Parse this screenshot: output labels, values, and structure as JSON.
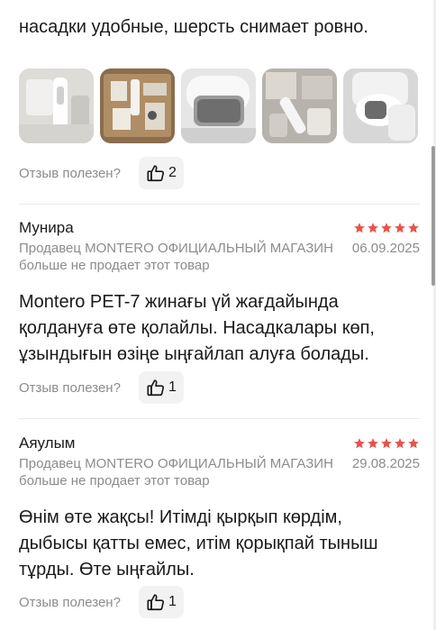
{
  "previous_review": {
    "text_tail": "насадки удобные, шерсть снимает ровно.",
    "photos": [
      {
        "icon": "vacuum-photo-1"
      },
      {
        "icon": "vacuum-accessories-photo"
      },
      {
        "icon": "vacuum-dust-container-photo"
      },
      {
        "icon": "vacuum-attachments-photo"
      },
      {
        "icon": "vacuum-handheld-photo"
      }
    ],
    "helpful_label": "Отзыв полезен?",
    "likes": "2"
  },
  "reviews": [
    {
      "author": "Мунира",
      "rating": 5,
      "seller": "Продавец MONTERO ОФИЦИАЛЬНЫЙ МАГАЗИН",
      "date": "06.09.2025",
      "seller_note": "больше не продает этот товар",
      "text": "Montero PET-7 жинағы үй жағдайында қолдануға өте қолайлы. Насадкалары көп, ұзындығын өзіңе ыңғайлап алуға болады.",
      "helpful_label": "Отзыв полезен?",
      "likes": "1"
    },
    {
      "author": "Аяулым",
      "rating": 5,
      "seller": "Продавец MONTERO ОФИЦИАЛЬНЫЙ МАГАЗИН",
      "date": "29.08.2025",
      "seller_note": "больше не продает этот товар",
      "text": "Өнім өте жақсы! Итімді қырқып көрдім, дыбысы қатты емес, итім қорықпай тыныш тұрды. Өте ыңғайлы.",
      "helpful_label": "Отзыв полезен?",
      "likes": "1"
    }
  ],
  "colors": {
    "star": "#e8524a",
    "muted_text": "#8c8c8c",
    "button_bg": "#f2f2f2"
  }
}
